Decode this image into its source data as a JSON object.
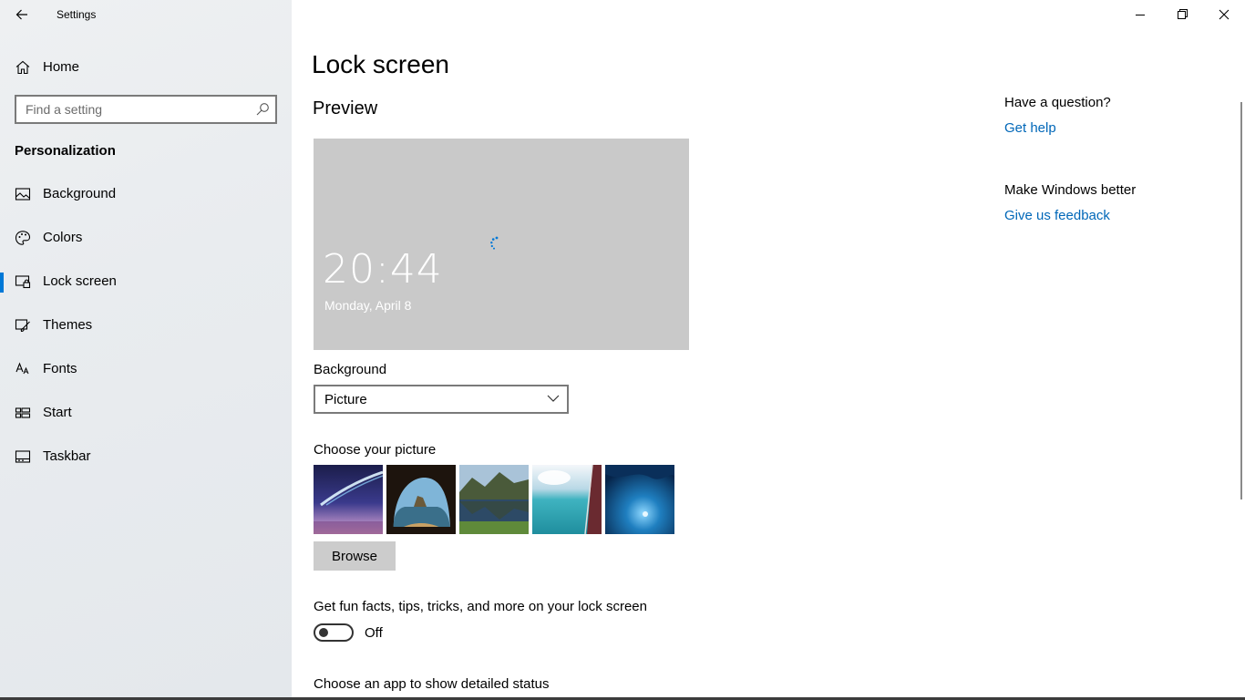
{
  "window": {
    "app_title": "Settings"
  },
  "sidebar": {
    "home_label": "Home",
    "search_placeholder": "Find a setting",
    "section": "Personalization",
    "items": [
      {
        "label": "Background",
        "icon": "picture-icon"
      },
      {
        "label": "Colors",
        "icon": "palette-icon"
      },
      {
        "label": "Lock screen",
        "icon": "lock-screen-icon",
        "selected": true
      },
      {
        "label": "Themes",
        "icon": "brush-icon"
      },
      {
        "label": "Fonts",
        "icon": "font-icon"
      },
      {
        "label": "Start",
        "icon": "start-icon"
      },
      {
        "label": "Taskbar",
        "icon": "taskbar-icon"
      }
    ]
  },
  "main": {
    "title": "Lock screen",
    "preview_heading": "Preview",
    "preview": {
      "time": "20:44",
      "date": "Monday, April 8"
    },
    "background_label": "Background",
    "background_value": "Picture",
    "choose_picture_label": "Choose your picture",
    "browse_label": "Browse",
    "fun_facts_label": "Get fun facts, tips, tricks, and more on your lock screen",
    "fun_facts_state": "Off",
    "status_label": "Choose an app to show detailed status"
  },
  "help": {
    "question": "Have a question?",
    "get_help": "Get help",
    "better": "Make Windows better",
    "feedback": "Give us feedback"
  },
  "colors": {
    "accent": "#0078d7",
    "link": "#0067b8",
    "preview_bg": "#c9c9c9"
  }
}
